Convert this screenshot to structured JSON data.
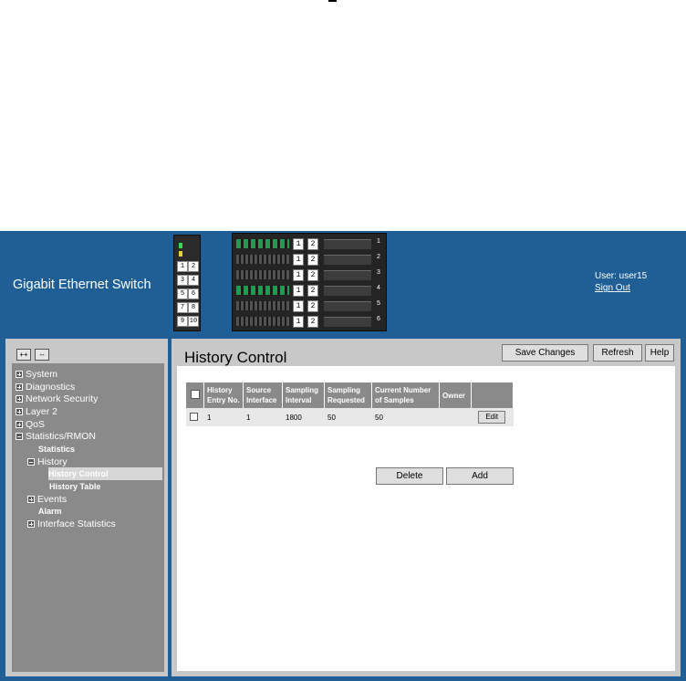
{
  "header": {
    "product_title": "Gigabit Ethernet Switch",
    "user_label": "User: user15",
    "sign_out": "Sign Out"
  },
  "device": {
    "small_ports": [
      "1",
      "2",
      "3",
      "4",
      "5",
      "6",
      "7",
      "8",
      "9",
      "10"
    ],
    "slots": [
      {
        "b1": "1",
        "b2": "2",
        "num": "1"
      },
      {
        "b1": "1",
        "b2": "2",
        "num": "2"
      },
      {
        "b1": "1",
        "b2": "2",
        "num": "3"
      },
      {
        "b1": "1",
        "b2": "2",
        "num": "4"
      },
      {
        "b1": "1",
        "b2": "2",
        "num": "5"
      },
      {
        "b1": "1",
        "b2": "2",
        "num": "6"
      }
    ]
  },
  "sidebar": {
    "expand_all": "++",
    "collapse_all": "--",
    "items": [
      {
        "label": "System",
        "expander": "plus"
      },
      {
        "label": "Diagnostics",
        "expander": "plus"
      },
      {
        "label": "Network Security",
        "expander": "plus"
      },
      {
        "label": "Layer 2",
        "expander": "plus"
      },
      {
        "label": "QoS",
        "expander": "plus"
      },
      {
        "label": "Statistics/RMON",
        "expander": "minus"
      },
      {
        "label": "Statistics"
      },
      {
        "label": "History",
        "expander": "minus"
      },
      {
        "label": "History Control",
        "selected": true
      },
      {
        "label": "History Table"
      },
      {
        "label": "Events",
        "expander": "plus"
      },
      {
        "label": "Alarm"
      },
      {
        "label": "Interface Statistics",
        "expander": "plus"
      }
    ]
  },
  "main": {
    "title": "History Control",
    "save_changes": "Save Changes",
    "refresh": "Refresh",
    "help": "Help",
    "table": {
      "headers": [
        "History Entry No.",
        "Source Interface",
        "Sampling Interval",
        "Sampling Requested",
        "Current Number of Samples",
        "Owner"
      ],
      "rows": [
        {
          "entry": "1",
          "source": "1",
          "interval": "1800",
          "requested": "50",
          "current": "50",
          "owner": "",
          "edit": "Edit"
        }
      ]
    },
    "delete": "Delete",
    "add": "Add"
  },
  "colors": {
    "frame_blue": "#1f5f96",
    "panel_gray": "#c8c8c8",
    "nav_gray": "#8a8a8a"
  }
}
